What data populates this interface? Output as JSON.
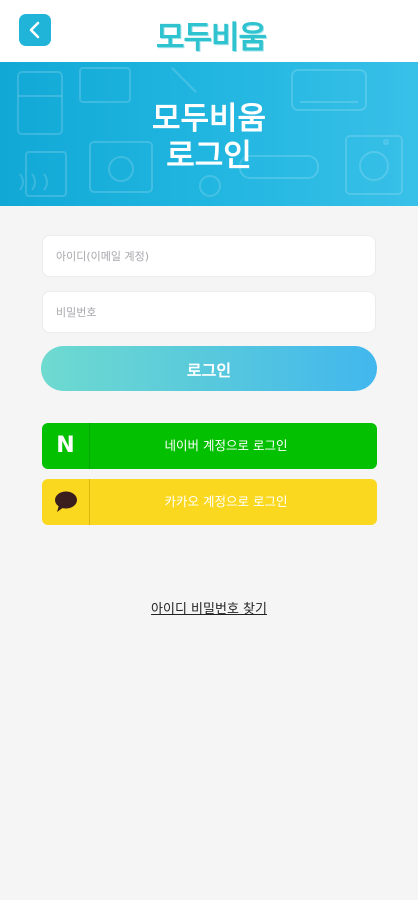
{
  "header": {
    "back_icon": "chevron-left-icon",
    "logo_text": "모두비움",
    "brand_color": "#1fb4d8"
  },
  "banner": {
    "title_line1": "모두비움",
    "title_line2": "로그인",
    "background_color": "#1aaedb"
  },
  "form": {
    "email_placeholder": "아이디(이메일 계정)",
    "password_placeholder": "비밀번호",
    "login_label": "로그인"
  },
  "social": {
    "naver": {
      "icon": "naver-n-icon",
      "label": "네이버 계정으로 로그인",
      "color": "#03c100"
    },
    "kakao": {
      "icon": "speech-bubble-icon",
      "label": "카카오 계정으로 로그인",
      "color": "#fbd820"
    }
  },
  "footer": {
    "find_link": "아이디 비밀번호 찾기"
  }
}
